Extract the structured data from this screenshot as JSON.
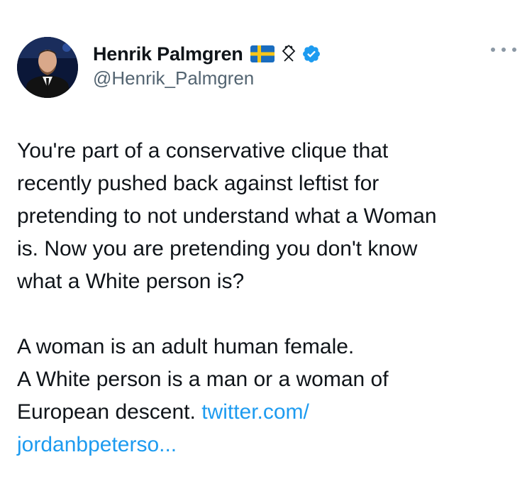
{
  "author": {
    "display_name": "Henrik Palmgren",
    "handle": "@Henrik_Palmgren",
    "emoji_flag": "sweden-flag-icon",
    "rune": "othala-rune-icon",
    "verified_badge": "verified-icon",
    "verified_color": "#1d9bf0"
  },
  "menu": {
    "icon": "more-horizontal-icon"
  },
  "tweet": {
    "paragraph1": [
      "You're part of a conservative clique that",
      "recently pushed back against leftist for",
      "pretending to not understand what a Woman",
      "is. Now you are pretending you don't know",
      "what a White person is?"
    ],
    "paragraph2": [
      "A woman is an adult human female.",
      "A White person is a man or a woman of"
    ],
    "last_line_text": "European descent. ",
    "link_part1": "twitter.com/",
    "link_part2": "jordanbpeterso..."
  },
  "colors": {
    "text": "#0f1419",
    "secondary": "#536471",
    "link": "#1d9bf0"
  }
}
